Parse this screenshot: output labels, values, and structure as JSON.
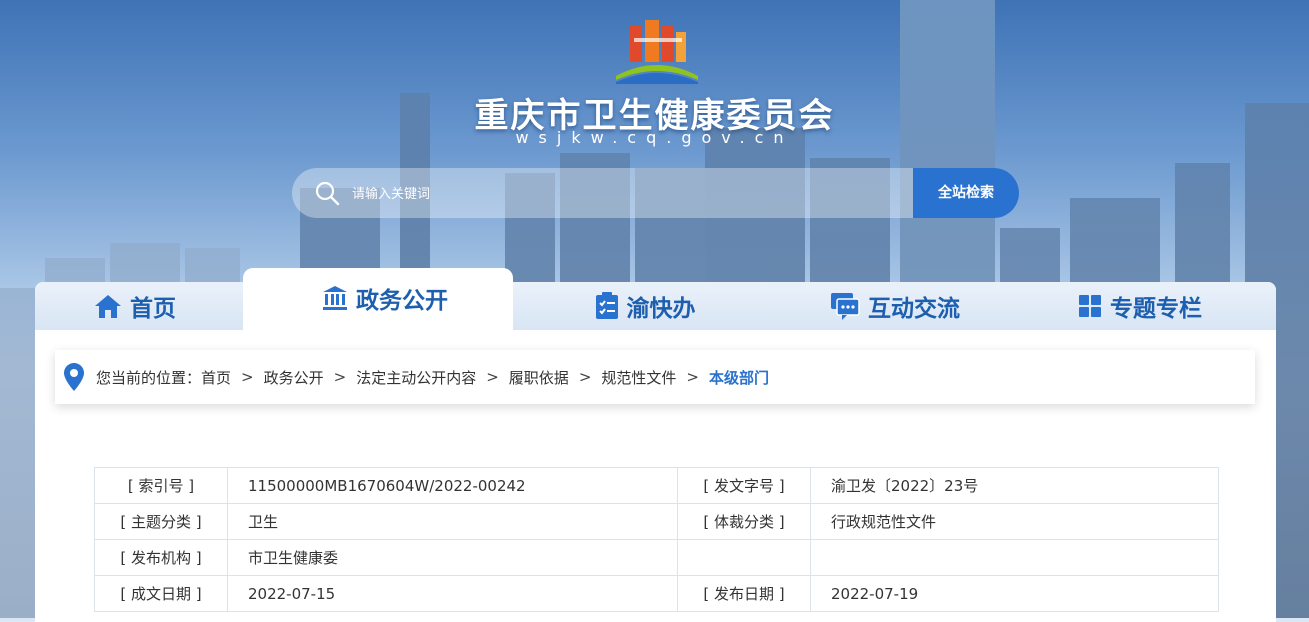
{
  "header": {
    "title": "重庆市卫生健康委员会",
    "domain": "wsjkw.cq.gov.cn"
  },
  "search": {
    "placeholder": "请输入关键词",
    "button_label": "全站检索"
  },
  "nav": {
    "tabs": [
      {
        "label": "首页",
        "icon": "home-icon"
      },
      {
        "label": "政务公开",
        "icon": "government-building-icon"
      },
      {
        "label": "渝快办",
        "icon": "checklist-icon"
      },
      {
        "label": "互动交流",
        "icon": "chat-icon"
      },
      {
        "label": "专题专栏",
        "icon": "grid-icon"
      }
    ],
    "active": "政务公开"
  },
  "breadcrumb": {
    "prefix": "您当前的位置：",
    "items": [
      "首页",
      "政务公开",
      "法定主动公开内容",
      "履职依据",
      "规范性文件"
    ],
    "current": "本级部门",
    "separator": ">"
  },
  "meta_table": {
    "rows": [
      {
        "l1": "[ 索引号 ]",
        "v1": "11500000MB1670604W/2022-00242",
        "l2": "[ 发文字号 ]",
        "v2": "渝卫发〔2022〕23号"
      },
      {
        "l1": "[ 主题分类 ]",
        "v1": "卫生",
        "l2": "[ 体裁分类 ]",
        "v2": "行政规范性文件"
      },
      {
        "l1": "[ 发布机构 ]",
        "v1": "市卫生健康委",
        "l2": "",
        "v2": ""
      },
      {
        "l1": "[ 成文日期 ]",
        "v1": "2022-07-15",
        "l2": "[ 发布日期 ]",
        "v2": "2022-07-19"
      }
    ]
  },
  "colors": {
    "accent": "#2a72cf",
    "nav_text": "#1d5fae"
  }
}
